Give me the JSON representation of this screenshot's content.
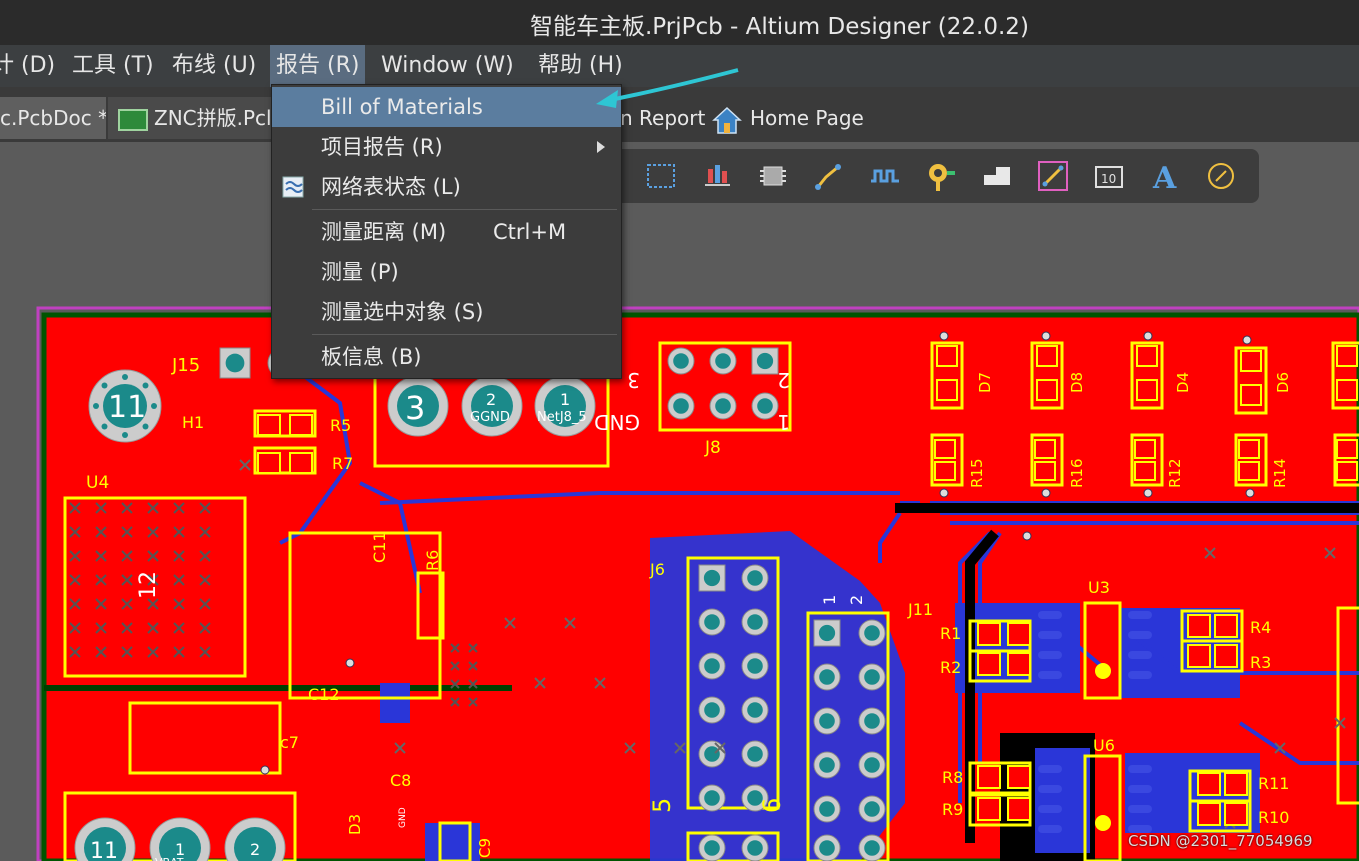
{
  "window": {
    "title": "智能车主板.PrjPcb - Altium Designer (22.0.2)"
  },
  "menubar": {
    "items": [
      "计 (D)",
      "工具 (T)",
      "布线 (U)",
      "报告 (R)",
      "Window (W)",
      "帮助 (H)"
    ],
    "display": [
      "计 (D)",
      "工具 (T)",
      "布线 (U)",
      "报告 (R)",
      "Window (W)",
      "帮助 (H)"
    ]
  },
  "tabs": {
    "tab1": "c.PcbDoc *",
    "tab2": "ZNC拼版.Pcl",
    "tab3": "n Report",
    "tab4": "Home Page"
  },
  "menu": {
    "items": [
      {
        "label": "Bill of Materials",
        "shortcut": ""
      },
      {
        "label": "项目报告 (R)",
        "shortcut": ""
      },
      {
        "label": "网络表状态 (L)",
        "shortcut": ""
      },
      {
        "label": "测量距离 (M)",
        "shortcut": "Ctrl+M"
      },
      {
        "label": "测量 (P)",
        "shortcut": ""
      },
      {
        "label": "测量选中对象 (S)",
        "shortcut": ""
      },
      {
        "label": "板信息 (B)",
        "shortcut": ""
      }
    ],
    "highlighted": "Bill of Materials"
  },
  "pcb": {
    "designators": [
      "J15",
      "H1",
      "R5",
      "R7",
      "U4",
      "C11",
      "R6",
      "J8",
      "J6",
      "J11",
      "C12",
      "c7",
      "C8",
      "D3",
      "C9",
      "U3",
      "R1",
      "R2",
      "R4",
      "R3",
      "U6",
      "R8",
      "R9",
      "R11",
      "R10",
      "D7",
      "D8",
      "D4",
      "D6",
      "R15",
      "R16",
      "R12",
      "R14"
    ],
    "pad_labels": [
      "11",
      "3",
      "2",
      "1",
      "3",
      "GND",
      "2",
      "1",
      "5",
      "6",
      "1",
      "2",
      "11",
      "12",
      "1",
      "2"
    ],
    "net_labels": [
      "GGND",
      "NetJ8_5",
      "VBAT",
      "GND"
    ]
  },
  "watermark": "CSDN @2301_77054969",
  "colors": {
    "top_layer": "#ff0000",
    "bottom_layer": "#2a36d8",
    "overlay": "#ffff00",
    "pad": "#1b8a8a",
    "board_outline": "#00aa00",
    "menu_highlight": "#5b7d9f",
    "arrow": "#2ec6d4"
  }
}
